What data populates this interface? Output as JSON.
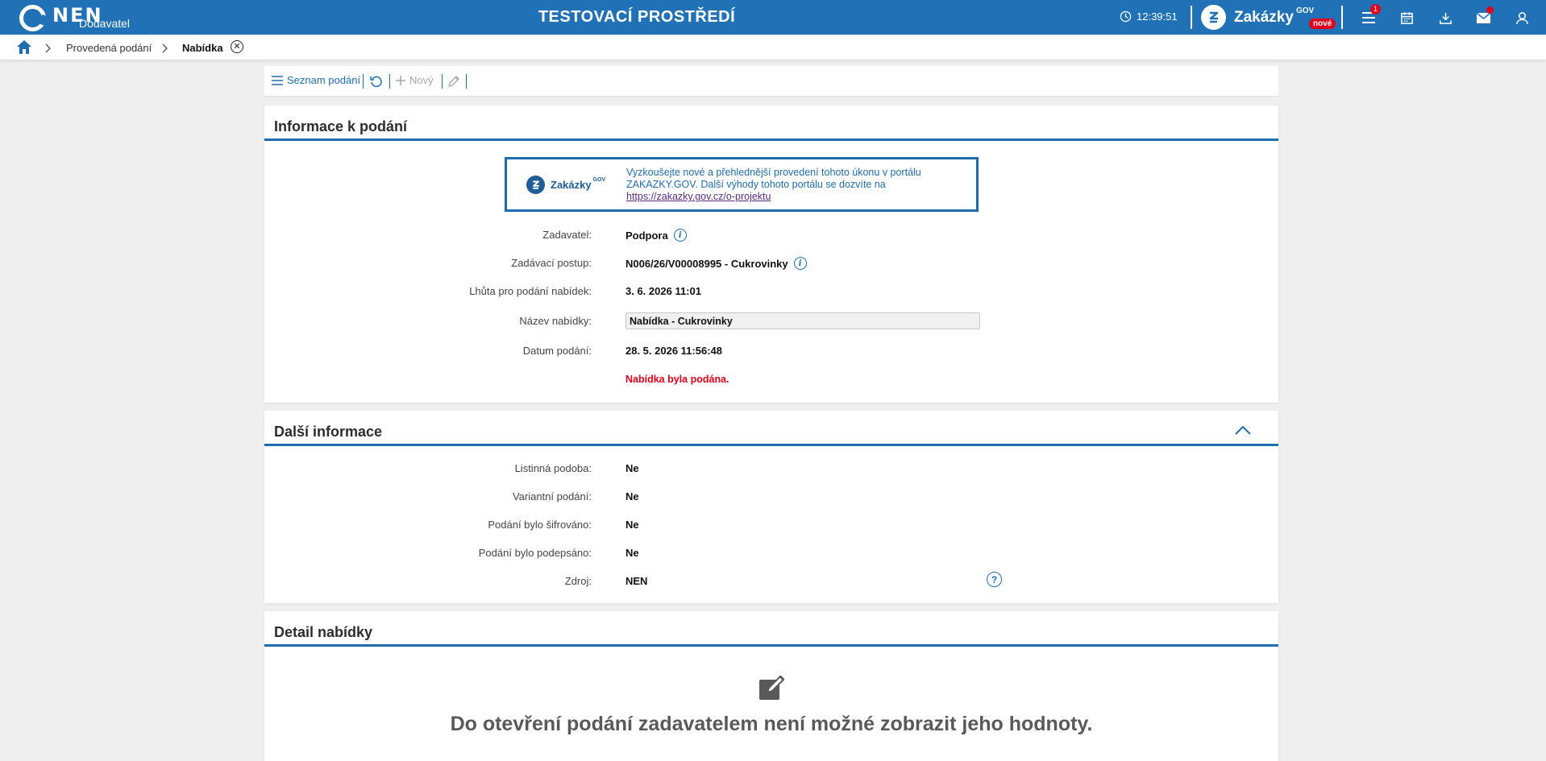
{
  "header": {
    "logo_text": "NEN",
    "logo_sub": "Dodavatel",
    "env_title": "TESTOVACÍ PROSTŘEDÍ",
    "time": "12:39:51",
    "zakazky_label": "Zakázky",
    "zakazky_gov": "GOV",
    "zakazky_new": "nové",
    "menu_badge": "1",
    "colors": {
      "bar": "#2071b5",
      "badge": "#e2001a"
    }
  },
  "breadcrumb": {
    "items": [
      {
        "label": "Provedená podání"
      },
      {
        "label": "Nabídka"
      }
    ]
  },
  "toolbar": {
    "list_label": "Seznam podání",
    "new_label": "Nový"
  },
  "info_panel": {
    "title": "Informace k podání",
    "promo": {
      "name": "Zakázky",
      "gov": "GOV",
      "text": "Vyzkoušejte nové a přehlednější provedení tohoto úkonu v portálu ZAKAZKY.GOV. Další výhody tohoto portálu se dozvíte na",
      "link": "https://zakazky.gov.cz/o-projektu"
    },
    "fields": {
      "zadavatel_label": "Zadavatel:",
      "zadavatel_value": "Podpora",
      "postup_label": "Zadávací postup:",
      "postup_value": "N006/26/V00008995 - Cukrovinky",
      "lhuta_label": "Lhůta pro podání nabídek:",
      "lhuta_value": "3. 6. 2026 11:01",
      "nazev_label": "Název nabídky:",
      "nazev_value": "Nabídka - Cukrovinky",
      "datum_label": "Datum podání:",
      "datum_value": "28. 5. 2026 11:56:48",
      "status": "Nabídka byla podána."
    }
  },
  "more_panel": {
    "title": "Další informace",
    "rows": [
      {
        "label": "Listinná podoba:",
        "value": "Ne"
      },
      {
        "label": "Variantní podání:",
        "value": "Ne"
      },
      {
        "label": "Podání bylo šifrováno:",
        "value": "Ne"
      },
      {
        "label": "Podání bylo podepsáno:",
        "value": "Ne"
      },
      {
        "label": "Zdroj:",
        "value": "NEN"
      }
    ]
  },
  "detail_panel": {
    "title": "Detail nabídky",
    "message": "Do otevření podání zadavatelem není možné zobrazit jeho hodnoty."
  }
}
